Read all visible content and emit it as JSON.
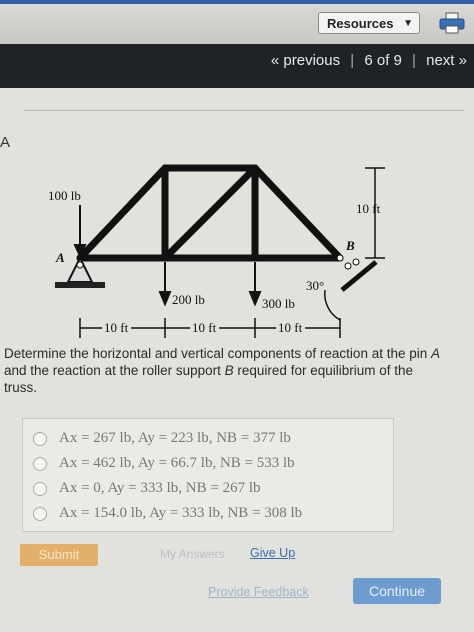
{
  "toolbar": {
    "resources_label": "Resources"
  },
  "nav": {
    "previous": "« previous",
    "position": "6 of 9",
    "next": "next »",
    "separator": "|"
  },
  "part": {
    "label": "A"
  },
  "diagram": {
    "load_A": "100 lb",
    "height_right": "10 ft",
    "label_A": "A",
    "label_B": "B",
    "angle": "30°",
    "load_1": "200 lb",
    "load_2": "300 lb",
    "span_1": "10 ft",
    "span_2": "10 ft",
    "span_3": "10 ft"
  },
  "question": {
    "part1": "Determine the horizontal and vertical components of reaction at the pin ",
    "pin": "A",
    "part2": " and the reaction at the roller support ",
    "roller": "B",
    "part3": " required for equilibrium of the truss."
  },
  "choices": [
    "Ax = 267 lb, Ay = 223 lb, NB = 377 lb",
    "Ax = 462 lb, Ay = 66.7 lb, NB = 533 lb",
    "Ax = 0, Ay = 333 lb, NB = 267 lb",
    "Ax = 154.0 lb, Ay = 333 lb, NB = 308 lb"
  ],
  "actions": {
    "submit": "Submit",
    "my_answers": "My Answers",
    "give_up": "Give Up",
    "feedback": "Provide Feedback",
    "continue": "Continue"
  }
}
